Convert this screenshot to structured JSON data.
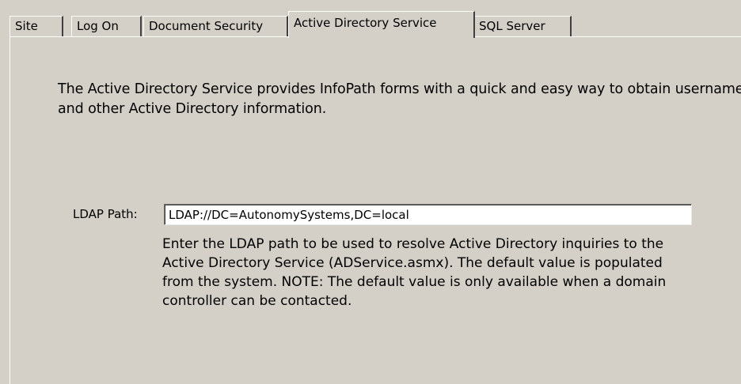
{
  "tabs": [
    {
      "label": "Site"
    },
    {
      "label": "Log On"
    },
    {
      "label": "Document Security"
    },
    {
      "label": "Active Directory Service",
      "active": true
    },
    {
      "label": "SQL Server"
    }
  ],
  "panel": {
    "intro_text": "The Active Directory Service provides InfoPath forms with  a quick and easy way to obtain  username and other Active Directory information.",
    "ldap": {
      "label": "LDAP Path:",
      "value": "LDAP://DC=AutonomySystems,DC=local"
    },
    "help_text": "Enter the LDAP path to be used to resolve Active Directory inquiries to the Active Directory Service (ADService.asmx).  The default value is populated from the system.  NOTE:  The default value is only  available when a domain controller can be contacted."
  },
  "colors": {
    "window_background": "#d4d0c8",
    "input_background": "#ffffff"
  }
}
